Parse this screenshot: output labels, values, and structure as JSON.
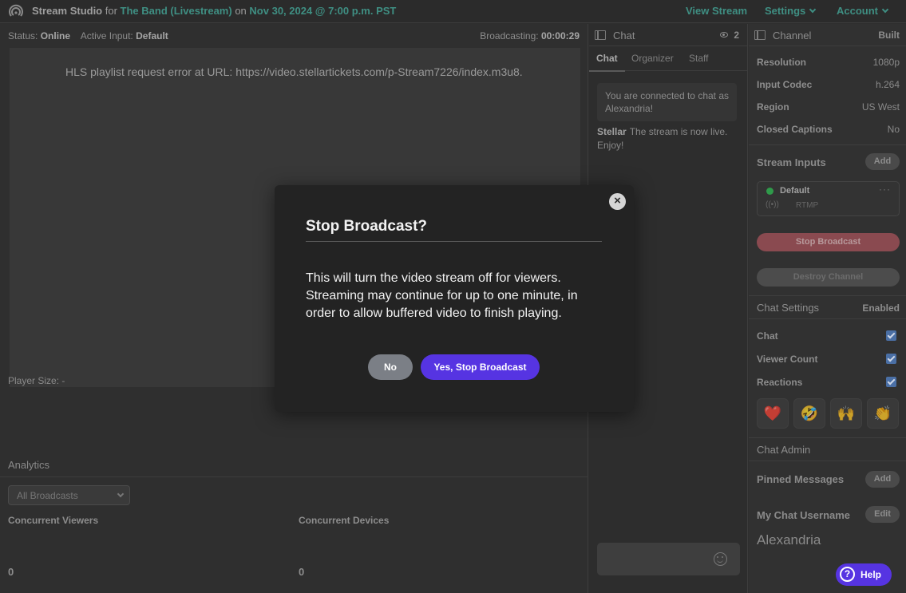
{
  "topbar": {
    "app_name": "Stream Studio",
    "for_text": "for",
    "event_name": "The Band (Livestream)",
    "on_text": "on",
    "event_date": "Nov 30, 2024 @ 7:00 p.m. PST",
    "nav": {
      "view_stream": "View Stream",
      "settings": "Settings",
      "account": "Account"
    }
  },
  "status": {
    "status_label": "Status:",
    "status_value": "Online",
    "input_label": "Active Input:",
    "input_value": "Default",
    "broadcasting_label": "Broadcasting:",
    "broadcasting_value": "00:00:29"
  },
  "player": {
    "error": "HLS playlist request error at URL: https://video.stellartickets.com/p-Stream7226/index.m3u8.",
    "size_label": "Player Size: -"
  },
  "analytics": {
    "title": "Analytics",
    "filter_selected": "All Broadcasts",
    "concurrent_viewers_label": "Concurrent Viewers",
    "concurrent_viewers_value": "0",
    "concurrent_devices_label": "Concurrent Devices",
    "concurrent_devices_value": "0"
  },
  "chat": {
    "title": "Chat",
    "viewer_count": "2",
    "tabs": [
      "Chat",
      "Organizer",
      "Staff"
    ],
    "system_message": "You are connected to chat as Alexandria!",
    "messages": [
      {
        "author": "Stellar",
        "text": "The stream is now live. Enjoy!"
      }
    ]
  },
  "channel": {
    "title": "Channel",
    "state": "Built",
    "props": [
      {
        "k": "Resolution",
        "v": "1080p"
      },
      {
        "k": "Input Codec",
        "v": "h.264"
      },
      {
        "k": "Region",
        "v": "US West"
      },
      {
        "k": "Closed Captions",
        "v": "No"
      }
    ],
    "stream_inputs_title": "Stream Inputs",
    "add_label": "Add",
    "input_name": "Default",
    "input_protocol": "RTMP",
    "input_more": "···",
    "stop_broadcast": "Stop Broadcast",
    "destroy_channel": "Destroy Channel",
    "chat_settings_title": "Chat Settings",
    "chat_settings_state": "Enabled",
    "toggles": [
      "Chat",
      "Viewer Count",
      "Reactions"
    ],
    "reactions": [
      "❤️",
      "🤣",
      "🙌",
      "👏"
    ],
    "chat_admin_title": "Chat Admin",
    "pinned_messages_title": "Pinned Messages",
    "pinned_add_label": "Add",
    "my_chat_username_title": "My Chat Username",
    "edit_label": "Edit",
    "username": "Alexandria"
  },
  "help": {
    "label": "Help",
    "glyph": "?"
  },
  "modal": {
    "title": "Stop Broadcast?",
    "body": "This will turn the video stream off for viewers. Streaming may continue for up to one minute, in order to allow buffered video to finish playing.",
    "no_label": "No",
    "yes_label": "Yes, Stop Broadcast",
    "close_glyph": "×"
  },
  "colors": {
    "accent": "#5634e2",
    "teal": "#3f8f83",
    "online_dot": "#2f9a4a"
  }
}
